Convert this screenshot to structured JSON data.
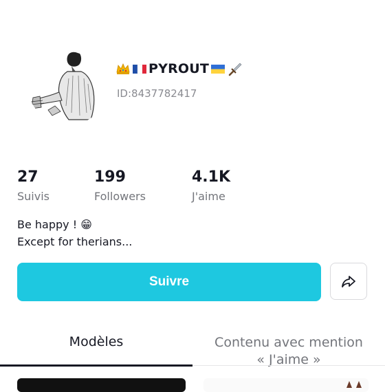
{
  "profile": {
    "display_name": "PYROUT",
    "user_id": "ID:8437782417",
    "name_emojis_left": [
      "crown-emoji",
      "france-flag-emoji"
    ],
    "name_emojis_right": [
      "ukraine-flag-emoji",
      "dagger-emoji"
    ],
    "avatar": "sketch-figure-avatar"
  },
  "stats": [
    {
      "value": "27",
      "label": "Suivis"
    },
    {
      "value": "199",
      "label": "Followers"
    },
    {
      "value": "4.1K",
      "label": "J'aime"
    }
  ],
  "bio": {
    "line1": "Be happy ! 😁",
    "line2": "Except for therians..."
  },
  "actions": {
    "follow_label": "Suivre",
    "share_icon": "share-icon"
  },
  "tabs": [
    {
      "label": "Modèles",
      "active": true
    },
    {
      "label": "Contenu avec mention",
      "label2": "« J'aime »",
      "active": false
    }
  ],
  "colors": {
    "accent": "#1ec8e0",
    "text": "#161823",
    "muted": "#73757b"
  }
}
